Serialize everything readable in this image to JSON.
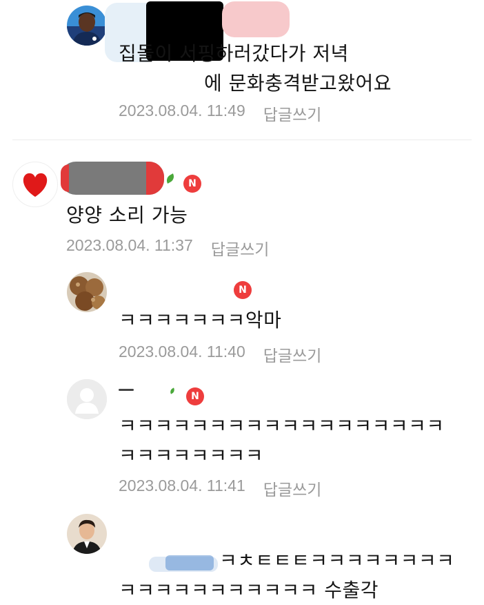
{
  "comments": [
    {
      "body": "집돌이 서핑하러갔다가 저녁\n에 문화충격받고왔어요",
      "timestamp": "2023.08.04. 11:49",
      "reply_label": "답글쓰기"
    },
    {
      "body": "양양 소리 가능",
      "timestamp": "2023.08.04. 11:37",
      "reply_label": "답글쓰기",
      "badge": "N"
    },
    {
      "body": "ㅋㅋㅋㅋㅋㅋㅋ악마",
      "timestamp": "2023.08.04. 11:40",
      "reply_label": "답글쓰기",
      "badge": "N"
    },
    {
      "body": "ㅋㅋㅋㅋㅋㅋㅋㅋㅋㅋㅋㅋㅋㅋㅋㅋㅋㅋ\nㅋㅋㅋㅋㅋㅋㅋㅋ",
      "timestamp": "2023.08.04. 11:41",
      "reply_label": "답글쓰기",
      "badge": "N"
    },
    {
      "body_line1": "ㅋㅊㅌㅌㅌㅋㅋㅋㅋㅋㅋㅋㅋ",
      "body_line2": "ㅋㅋㅋㅋㅋㅋㅋㅋㅋㅋㅋ 수출각"
    }
  ],
  "colors": {
    "badge": "#ee3d3d",
    "meta_text": "#9a9a9a",
    "body_text": "#141414",
    "divider": "#ececec"
  },
  "icons": [
    "profile-photo",
    "heart-icon",
    "new-badge",
    "default-profile-icon"
  ]
}
